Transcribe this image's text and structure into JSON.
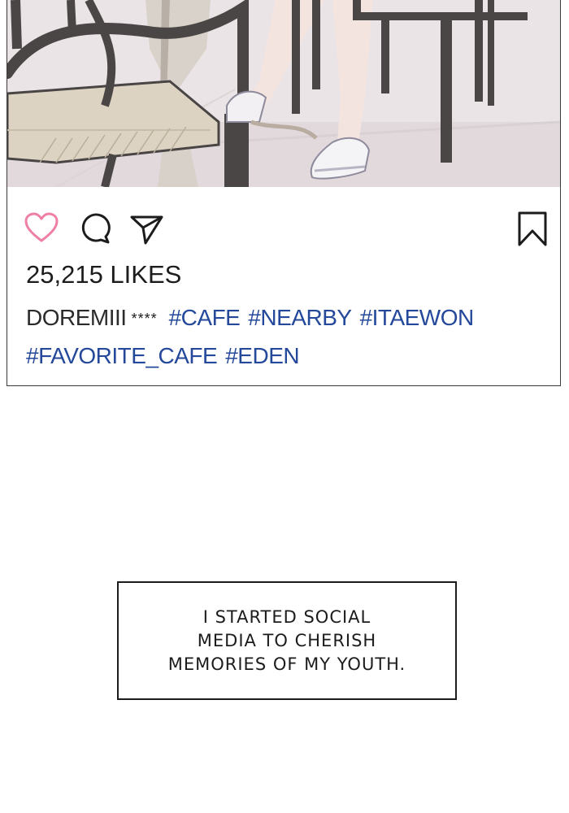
{
  "post": {
    "likes_text": "25,215 LIKES",
    "username": "DOREMIII",
    "username_suffix": "****",
    "hashtags": [
      "#CAFE",
      "#NEARBY",
      "#ITAEWON",
      "#FAVORITE_CAFE",
      "#EDEN"
    ],
    "colors": {
      "like": "#ef7fa3",
      "hashtag": "#24489a",
      "text": "#1c1c1c"
    },
    "icons": [
      "heart-icon",
      "comment-icon",
      "send-icon",
      "bookmark-icon"
    ]
  },
  "narration": {
    "lines": [
      "I STARTED SOCIAL",
      "MEDIA TO CHERISH",
      "MEMORIES OF MY YOUTH."
    ]
  }
}
